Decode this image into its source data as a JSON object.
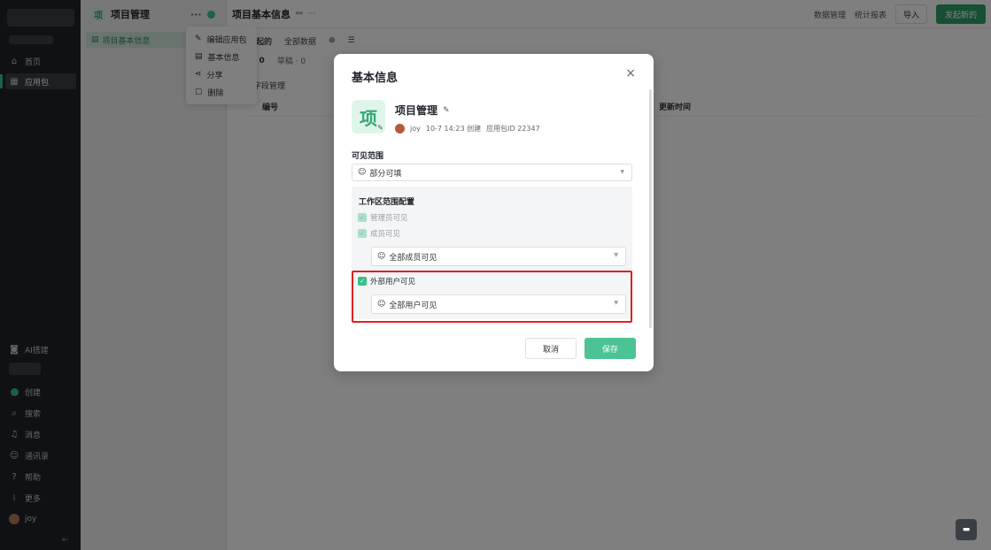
{
  "sidebar": {
    "items": [
      {
        "label": "首页",
        "icon": "home-icon"
      },
      {
        "label": "应用包",
        "icon": "grid-icon"
      }
    ],
    "bottom": [
      {
        "label": "AI搭建",
        "icon": "ai-icon"
      },
      {
        "label": "创建",
        "icon": "plus-dot-icon"
      },
      {
        "label": "搜索",
        "icon": "search-icon"
      },
      {
        "label": "消息",
        "icon": "bell-icon"
      },
      {
        "label": "通讯录",
        "icon": "contacts-icon"
      },
      {
        "label": "帮助",
        "icon": "help-icon"
      },
      {
        "label": "更多",
        "icon": "more-grid-icon"
      },
      {
        "label": "joy",
        "icon": "avatar"
      }
    ]
  },
  "panel": {
    "title": "项目管理",
    "logo_char": "项",
    "selected_item": "项目基本信息"
  },
  "header": {
    "page_title": "项目基本信息",
    "right_links": [
      "数据管理",
      "统计报表"
    ],
    "import_label": "导入",
    "new_label": "发起新的"
  },
  "content": {
    "tab_label": "发起的",
    "view_label": "全部数据",
    "count_a": "· 0",
    "count_b": "草稿 · 0",
    "toolbar": [
      "字段管理"
    ],
    "col_id": "编号",
    "col_updated": "更新时间"
  },
  "context_menu": {
    "items": [
      "编辑应用包",
      "基本信息",
      "分享",
      "删除"
    ]
  },
  "modal": {
    "title": "基本信息",
    "app_char": "项",
    "app_name": "项目管理",
    "creator": "joy",
    "created": "10-7 14:23 创建",
    "app_id": "应用包ID 22347",
    "visibility_label": "可见范围",
    "visibility_value": "部分可填",
    "workspace_title": "工作区范围配置",
    "admin_visible": "管理员可见",
    "member_visible": "成员可见",
    "member_scope": "全部成员可见",
    "external_visible": "外部用户可见",
    "external_scope": "全部用户可见",
    "cancel_label": "取消",
    "save_label": "保存"
  }
}
